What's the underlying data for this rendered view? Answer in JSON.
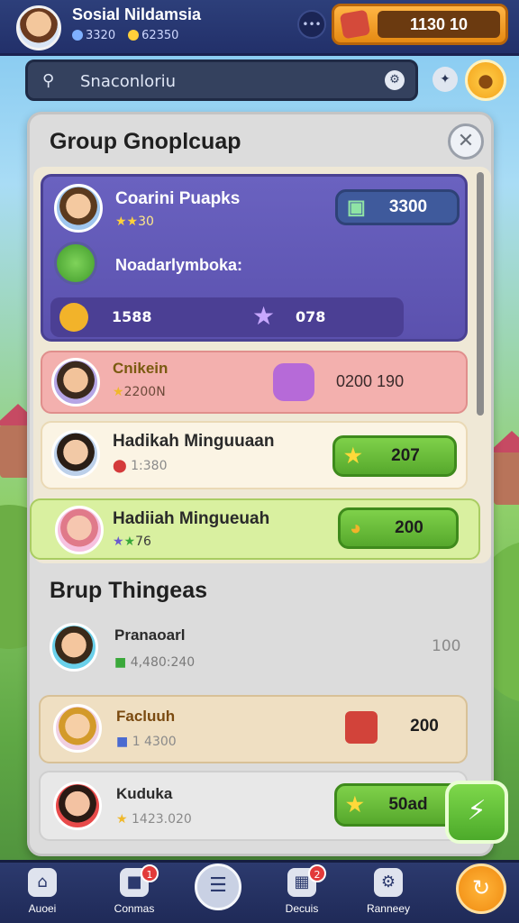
{
  "header": {
    "title": "Sosial Nildamsia",
    "stat_left": "3320",
    "stat_right": "62350",
    "currency_value": "1130 10"
  },
  "search": {
    "placeholder": "Snaconloriu"
  },
  "panel": {
    "title": "Group Gnoplcuap",
    "section_two_title": "Brup Thingeas",
    "rows": [
      {
        "name": "Coarini Puapks",
        "sub": "30",
        "value": "3300"
      },
      {
        "name": "Noadarlymboka:",
        "sub": ""
      },
      {
        "name": "",
        "sub": "1588",
        "value": "078"
      },
      {
        "name": "Cnikein",
        "sub": "2200N",
        "value": "0200 190"
      },
      {
        "name": "Hadikah Minguuaan",
        "sub": "1:380",
        "value": "207"
      },
      {
        "name": "Hadiiah Mingueuah",
        "sub": "76",
        "value": "200"
      },
      {
        "name": "Pranaoarl",
        "sub": "4,480:240",
        "value": "100"
      },
      {
        "name": "Facluuh",
        "sub": "1 4300",
        "value": "200"
      },
      {
        "name": "Kuduka",
        "sub": "1423.020",
        "value": "50ad"
      }
    ]
  },
  "nav": {
    "items": [
      {
        "label": "Auoei"
      },
      {
        "label": "Conmas",
        "badge": "1"
      },
      {
        "label": "Decuis",
        "badge": "2"
      },
      {
        "label": "Ranneey"
      }
    ]
  },
  "colors": {
    "accent": "#f3a21a",
    "header_bg": "#2d3f7a",
    "green_button": "#56a82c",
    "purple_row": "#5b51ae"
  },
  "icons": [
    "search-icon",
    "settings-icon",
    "close-icon",
    "star-icon",
    "home-icon",
    "gift-icon",
    "list-icon",
    "shop-icon",
    "gear-icon"
  ]
}
